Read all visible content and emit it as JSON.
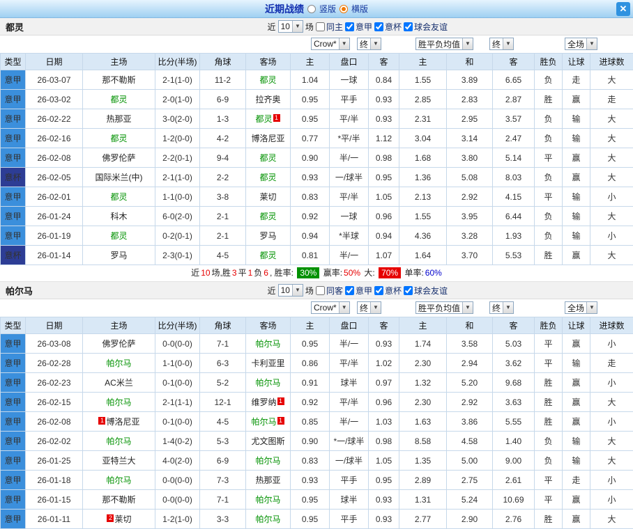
{
  "header": {
    "title": "近期战绩",
    "radio_vertical": "竖版",
    "radio_horizontal": "横版",
    "close": "✕"
  },
  "columns": [
    "类型",
    "日期",
    "主场",
    "比分(半场)",
    "角球",
    "客场",
    "主",
    "盘口",
    "客",
    "主",
    "和",
    "客",
    "胜负",
    "让球",
    "进球数"
  ],
  "colors": {
    "red": "#e60000",
    "green": "#009100",
    "league_jia": "#3b8fdc",
    "league_bei": "#2d3d95",
    "team_green": "#009100"
  },
  "sections": [
    {
      "team": "都灵",
      "near_label": "近",
      "count": "10",
      "games_label": "场",
      "checkboxes": [
        {
          "label": "同主",
          "checked": false
        },
        {
          "label": "意甲",
          "checked": true
        },
        {
          "label": "意杯",
          "checked": true
        },
        {
          "label": "球会友谊",
          "checked": true
        }
      ],
      "filters": {
        "bookmaker": "Crow*",
        "final1": "终",
        "avg": "胜平负均值",
        "final2": "终",
        "scope": "全场"
      },
      "rows": [
        {
          "lg": "意甲",
          "lgc": "jia",
          "dt": "26-03-07",
          "hm": "那不勒斯",
          "hmg": false,
          "hb": "",
          "sc": "2-1(1-0)",
          "cr": "11-2",
          "aw": "都灵",
          "awg": true,
          "ab": "",
          "o1": "1.04",
          "hk": "一球",
          "o2": "0.84",
          "a1": "1.55",
          "a2": "3.89",
          "a3": "6.65",
          "rs": "负",
          "rsc": "g",
          "lt": "走",
          "ltc": "k",
          "gl": "大",
          "glc": "r"
        },
        {
          "lg": "意甲",
          "lgc": "jia",
          "dt": "26-03-02",
          "hm": "都灵",
          "hmg": true,
          "hb": "",
          "sc": "2-0(1-0)",
          "cr": "6-9",
          "aw": "拉齐奥",
          "awg": false,
          "ab": "",
          "o1": "0.95",
          "hk": "平手",
          "o2": "0.93",
          "a1": "2.85",
          "a2": "2.83",
          "a3": "2.87",
          "rs": "胜",
          "rsc": "r",
          "lt": "赢",
          "ltc": "r",
          "gl": "走",
          "glc": "r"
        },
        {
          "lg": "意甲",
          "lgc": "jia",
          "dt": "26-02-22",
          "hm": "热那亚",
          "hmg": false,
          "hb": "",
          "sc": "3-0(2-0)",
          "cr": "1-3",
          "aw": "都灵",
          "awg": true,
          "ab": "1",
          "o1": "0.95",
          "hk": "平/半",
          "o2": "0.93",
          "a1": "2.31",
          "a2": "2.95",
          "a3": "3.57",
          "rs": "负",
          "rsc": "g",
          "lt": "输",
          "ltc": "g",
          "gl": "大",
          "glc": "r"
        },
        {
          "lg": "意甲",
          "lgc": "jia",
          "dt": "26-02-16",
          "hm": "都灵",
          "hmg": true,
          "hb": "",
          "sc": "1-2(0-0)",
          "cr": "4-2",
          "aw": "博洛尼亚",
          "awg": false,
          "ab": "",
          "o1": "0.77",
          "hk": "*平/半",
          "o2": "1.12",
          "a1": "3.04",
          "a2": "3.14",
          "a3": "2.47",
          "rs": "负",
          "rsc": "g",
          "lt": "输",
          "ltc": "g",
          "gl": "大",
          "glc": "r"
        },
        {
          "lg": "意甲",
          "lgc": "jia",
          "dt": "26-02-08",
          "hm": "佛罗伦萨",
          "hmg": false,
          "hb": "",
          "sc": "2-2(0-1)",
          "cr": "9-4",
          "aw": "都灵",
          "awg": true,
          "ab": "",
          "o1": "0.90",
          "hk": "半/一",
          "o2": "0.98",
          "a1": "1.68",
          "a2": "3.80",
          "a3": "5.14",
          "rs": "平",
          "rsc": "k",
          "lt": "赢",
          "ltc": "r",
          "gl": "大",
          "glc": "r"
        },
        {
          "lg": "意杯",
          "lgc": "bei",
          "dt": "26-02-05",
          "hm": "国际米兰(中)",
          "hmg": false,
          "hb": "",
          "sc": "2-1(1-0)",
          "cr": "2-2",
          "aw": "都灵",
          "awg": true,
          "ab": "",
          "o1": "0.93",
          "hk": "一/球半",
          "o2": "0.95",
          "a1": "1.36",
          "a2": "5.08",
          "a3": "8.03",
          "rs": "负",
          "rsc": "g",
          "lt": "赢",
          "ltc": "r",
          "gl": "大",
          "glc": "r"
        },
        {
          "lg": "意甲",
          "lgc": "jia",
          "dt": "26-02-01",
          "hm": "都灵",
          "hmg": true,
          "hb": "",
          "sc": "1-1(0-0)",
          "cr": "3-8",
          "aw": "莱切",
          "awg": false,
          "ab": "",
          "o1": "0.83",
          "hk": "平/半",
          "o2": "1.05",
          "a1": "2.13",
          "a2": "2.92",
          "a3": "4.15",
          "rs": "平",
          "rsc": "k",
          "lt": "输",
          "ltc": "g",
          "gl": "小",
          "glc": "r"
        },
        {
          "lg": "意甲",
          "lgc": "jia",
          "dt": "26-01-24",
          "hm": "科木",
          "hmg": false,
          "hb": "",
          "sc": "6-0(2-0)",
          "cr": "2-1",
          "aw": "都灵",
          "awg": true,
          "ab": "",
          "o1": "0.92",
          "hk": "一球",
          "o2": "0.96",
          "a1": "1.55",
          "a2": "3.95",
          "a3": "6.44",
          "rs": "负",
          "rsc": "g",
          "lt": "输",
          "ltc": "g",
          "gl": "大",
          "glc": "r"
        },
        {
          "lg": "意甲",
          "lgc": "jia",
          "dt": "26-01-19",
          "hm": "都灵",
          "hmg": true,
          "hb": "",
          "sc": "0-2(0-1)",
          "cr": "2-1",
          "aw": "罗马",
          "awg": false,
          "ab": "",
          "o1": "0.94",
          "hk": "*半球",
          "o2": "0.94",
          "a1": "4.36",
          "a2": "3.28",
          "a3": "1.93",
          "rs": "负",
          "rsc": "g",
          "lt": "输",
          "ltc": "g",
          "gl": "小",
          "glc": "r"
        },
        {
          "lg": "意杯",
          "lgc": "bei",
          "dt": "26-01-14",
          "hm": "罗马",
          "hmg": false,
          "hb": "",
          "sc": "2-3(0-1)",
          "cr": "4-5",
          "aw": "都灵",
          "awg": true,
          "ab": "",
          "o1": "0.81",
          "hk": "半/一",
          "o2": "1.07",
          "a1": "1.64",
          "a2": "3.70",
          "a3": "5.53",
          "rs": "胜",
          "rsc": "r",
          "lt": "赢",
          "ltc": "r",
          "gl": "大",
          "glc": "r"
        }
      ],
      "summary_parts": [
        {
          "t": "近",
          "s": "k"
        },
        {
          "t": "10",
          "s": "r"
        },
        {
          "t": "场,胜",
          "s": "k"
        },
        {
          "t": "3",
          "s": "r"
        },
        {
          "t": "平",
          "s": "k"
        },
        {
          "t": "1",
          "s": "r"
        },
        {
          "t": "负",
          "s": "k"
        },
        {
          "t": "6",
          "s": "r"
        },
        {
          "t": ", 胜率: ",
          "s": "k"
        },
        {
          "t": "30%",
          "s": "gb"
        },
        {
          "t": " 赢率:",
          "s": "k"
        },
        {
          "t": "50%",
          "s": "r"
        },
        {
          "t": " 大: ",
          "s": "k"
        },
        {
          "t": "70%",
          "s": "rb"
        },
        {
          "t": " 单率:",
          "s": "k"
        },
        {
          "t": "60%",
          "s": "bl"
        }
      ]
    },
    {
      "team": "帕尔马",
      "near_label": "近",
      "count": "10",
      "games_label": "场",
      "checkboxes": [
        {
          "label": "同客",
          "checked": false
        },
        {
          "label": "意甲",
          "checked": true
        },
        {
          "label": "意杯",
          "checked": true
        },
        {
          "label": "球会友谊",
          "checked": true
        }
      ],
      "filters": {
        "bookmaker": "Crow*",
        "final1": "终",
        "avg": "胜平负均值",
        "final2": "终",
        "scope": "全场"
      },
      "rows": [
        {
          "lg": "意甲",
          "lgc": "jia",
          "dt": "26-03-08",
          "hm": "佛罗伦萨",
          "hmg": false,
          "hb": "",
          "sc": "0-0(0-0)",
          "cr": "7-1",
          "aw": "帕尔马",
          "awg": true,
          "ab": "",
          "o1": "0.95",
          "hk": "半/一",
          "o2": "0.93",
          "a1": "1.74",
          "a2": "3.58",
          "a3": "5.03",
          "rs": "平",
          "rsc": "k",
          "lt": "赢",
          "ltc": "r",
          "gl": "小",
          "glc": "r"
        },
        {
          "lg": "意甲",
          "lgc": "jia",
          "dt": "26-02-28",
          "hm": "帕尔马",
          "hmg": true,
          "hb": "",
          "sc": "1-1(0-0)",
          "cr": "6-3",
          "aw": "卡利亚里",
          "awg": false,
          "ab": "",
          "o1": "0.86",
          "hk": "平/半",
          "o2": "1.02",
          "a1": "2.30",
          "a2": "2.94",
          "a3": "3.62",
          "rs": "平",
          "rsc": "k",
          "lt": "输",
          "ltc": "g",
          "gl": "走",
          "glc": "r"
        },
        {
          "lg": "意甲",
          "lgc": "jia",
          "dt": "26-02-23",
          "hm": "AC米兰",
          "hmg": false,
          "hb": "",
          "sc": "0-1(0-0)",
          "cr": "5-2",
          "aw": "帕尔马",
          "awg": true,
          "ab": "",
          "o1": "0.91",
          "hk": "球半",
          "o2": "0.97",
          "a1": "1.32",
          "a2": "5.20",
          "a3": "9.68",
          "rs": "胜",
          "rsc": "r",
          "lt": "赢",
          "ltc": "r",
          "gl": "小",
          "glc": "r"
        },
        {
          "lg": "意甲",
          "lgc": "jia",
          "dt": "26-02-15",
          "hm": "帕尔马",
          "hmg": true,
          "hb": "",
          "sc": "2-1(1-1)",
          "cr": "12-1",
          "aw": "维罗纳",
          "awg": false,
          "ab": "1",
          "o1": "0.92",
          "hk": "平/半",
          "o2": "0.96",
          "a1": "2.30",
          "a2": "2.92",
          "a3": "3.63",
          "rs": "胜",
          "rsc": "r",
          "lt": "赢",
          "ltc": "r",
          "gl": "大",
          "glc": "r"
        },
        {
          "lg": "意甲",
          "lgc": "jia",
          "dt": "26-02-08",
          "hm": "博洛尼亚",
          "hmg": false,
          "hb": "1",
          "sc": "0-1(0-0)",
          "cr": "4-5",
          "aw": "帕尔马",
          "awg": true,
          "ab": "1",
          "o1": "0.85",
          "hk": "半/一",
          "o2": "1.03",
          "a1": "1.63",
          "a2": "3.86",
          "a3": "5.55",
          "rs": "胜",
          "rsc": "r",
          "lt": "赢",
          "ltc": "r",
          "gl": "小",
          "glc": "r"
        },
        {
          "lg": "意甲",
          "lgc": "jia",
          "dt": "26-02-02",
          "hm": "帕尔马",
          "hmg": true,
          "hb": "",
          "sc": "1-4(0-2)",
          "cr": "5-3",
          "aw": "尤文图斯",
          "awg": false,
          "ab": "",
          "o1": "0.90",
          "hk": "*一/球半",
          "o2": "0.98",
          "a1": "8.58",
          "a2": "4.58",
          "a3": "1.40",
          "rs": "负",
          "rsc": "g",
          "lt": "输",
          "ltc": "g",
          "gl": "大",
          "glc": "r"
        },
        {
          "lg": "意甲",
          "lgc": "jia",
          "dt": "26-01-25",
          "hm": "亚特兰大",
          "hmg": false,
          "hb": "",
          "sc": "4-0(2-0)",
          "cr": "6-9",
          "aw": "帕尔马",
          "awg": true,
          "ab": "",
          "o1": "0.83",
          "hk": "一/球半",
          "o2": "1.05",
          "a1": "1.35",
          "a2": "5.00",
          "a3": "9.00",
          "rs": "负",
          "rsc": "g",
          "lt": "输",
          "ltc": "g",
          "gl": "大",
          "glc": "r"
        },
        {
          "lg": "意甲",
          "lgc": "jia",
          "dt": "26-01-18",
          "hm": "帕尔马",
          "hmg": true,
          "hb": "",
          "sc": "0-0(0-0)",
          "cr": "7-3",
          "aw": "热那亚",
          "awg": false,
          "ab": "",
          "o1": "0.93",
          "hk": "平手",
          "o2": "0.95",
          "a1": "2.89",
          "a2": "2.75",
          "a3": "2.61",
          "rs": "平",
          "rsc": "k",
          "lt": "走",
          "ltc": "k",
          "gl": "小",
          "glc": "r"
        },
        {
          "lg": "意甲",
          "lgc": "jia",
          "dt": "26-01-15",
          "hm": "那不勒斯",
          "hmg": false,
          "hb": "",
          "sc": "0-0(0-0)",
          "cr": "7-1",
          "aw": "帕尔马",
          "awg": true,
          "ab": "",
          "o1": "0.95",
          "hk": "球半",
          "o2": "0.93",
          "a1": "1.31",
          "a2": "5.24",
          "a3": "10.69",
          "rs": "平",
          "rsc": "k",
          "lt": "赢",
          "ltc": "r",
          "gl": "小",
          "glc": "r"
        },
        {
          "lg": "意甲",
          "lgc": "jia",
          "dt": "26-01-11",
          "hm": "莱切",
          "hmg": false,
          "hb": "2",
          "sc": "1-2(1-0)",
          "cr": "3-3",
          "aw": "帕尔马",
          "awg": true,
          "ab": "",
          "o1": "0.95",
          "hk": "平手",
          "o2": "0.93",
          "a1": "2.77",
          "a2": "2.90",
          "a3": "2.76",
          "rs": "胜",
          "rsc": "r",
          "lt": "赢",
          "ltc": "r",
          "gl": "大",
          "glc": "r"
        }
      ],
      "summary_parts": []
    }
  ]
}
